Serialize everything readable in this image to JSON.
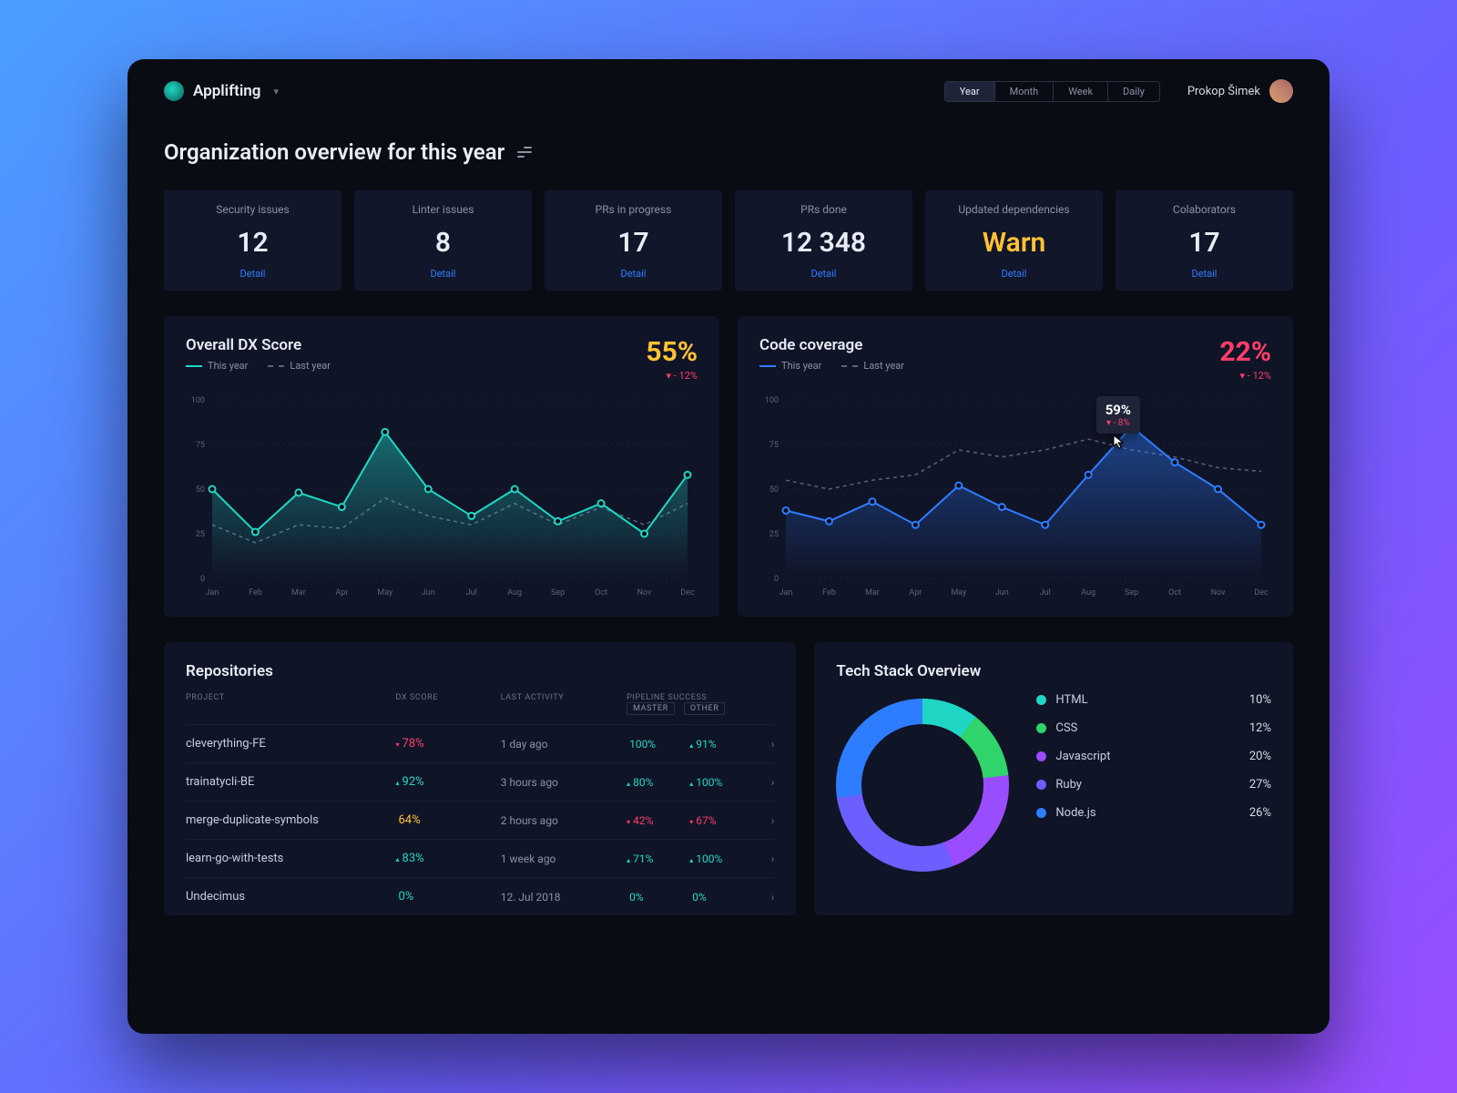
{
  "header": {
    "brand": "Applifting",
    "periods": [
      "Year",
      "Month",
      "Week",
      "Daily"
    ],
    "active_period": 0,
    "user": "Prokop Šimek"
  },
  "page_title": "Organization overview for this year",
  "stats": [
    {
      "label": "Security issues",
      "value": "12",
      "link": "Detail",
      "warn": false
    },
    {
      "label": "Linter issues",
      "value": "8",
      "link": "Detail",
      "warn": false
    },
    {
      "label": "PRs in progress",
      "value": "17",
      "link": "Detail",
      "warn": false
    },
    {
      "label": "PRs done",
      "value": "12 348",
      "link": "Detail",
      "warn": false
    },
    {
      "label": "Updated dependencies",
      "value": "Warn",
      "link": "Detail",
      "warn": true
    },
    {
      "label": "Colaborators",
      "value": "17",
      "link": "Detail",
      "warn": false
    }
  ],
  "dx_chart": {
    "title": "Overall DX Score",
    "value": "55%",
    "delta": "- 12%",
    "legend_this": "This year",
    "legend_last": "Last year",
    "color": "#1fd6c4"
  },
  "cov_chart": {
    "title": "Code coverage",
    "value": "22%",
    "delta": "- 12%",
    "legend_this": "This year",
    "legend_last": "Last year",
    "color": "#2e7cff",
    "tooltip_val": "59%",
    "tooltip_delta": "- 8%"
  },
  "chart_data": [
    {
      "type": "line",
      "title": "Overall DX Score",
      "categories": [
        "Jan",
        "Feb",
        "Mar",
        "Apr",
        "May",
        "Jun",
        "Jul",
        "Aug",
        "Sep",
        "Oct",
        "Nov",
        "Dec"
      ],
      "ylim": [
        0,
        100
      ],
      "series": [
        {
          "name": "This year",
          "values": [
            50,
            26,
            48,
            40,
            82,
            50,
            35,
            50,
            32,
            42,
            25,
            58
          ]
        },
        {
          "name": "Last year",
          "values": [
            30,
            20,
            30,
            28,
            45,
            35,
            30,
            42,
            30,
            40,
            30,
            42
          ]
        }
      ]
    },
    {
      "type": "line",
      "title": "Code coverage",
      "categories": [
        "Jan",
        "Feb",
        "Mar",
        "Apr",
        "May",
        "Jun",
        "Jul",
        "Aug",
        "Sep",
        "Oct",
        "Nov",
        "Dec"
      ],
      "ylim": [
        0,
        100
      ],
      "series": [
        {
          "name": "This year",
          "values": [
            38,
            32,
            43,
            30,
            52,
            40,
            30,
            58,
            85,
            65,
            50,
            30
          ]
        },
        {
          "name": "Last year",
          "values": [
            55,
            50,
            55,
            58,
            72,
            68,
            72,
            78,
            72,
            68,
            62,
            60
          ]
        }
      ]
    },
    {
      "type": "pie",
      "title": "Tech Stack Overview",
      "categories": [
        "HTML",
        "CSS",
        "Javascript",
        "Ruby",
        "Node.js"
      ],
      "values": [
        10,
        12,
        20,
        27,
        26
      ]
    }
  ],
  "repos": {
    "title": "Repositories",
    "col_project": "PROJECT",
    "col_score": "DX SCORE",
    "col_activity": "LAST ACTIVITY",
    "col_pipeline": "PIPELINE SUCCESS",
    "pipe_a": "master",
    "pipe_b": "other",
    "rows": [
      {
        "project": "cleverything-FE",
        "score": "78%",
        "score_dir": "down",
        "activity": "1 day ago",
        "master": "100%",
        "master_dir": "",
        "other": "91%",
        "other_dir": "up"
      },
      {
        "project": "trainatycli-BE",
        "score": "92%",
        "score_dir": "up",
        "activity": "3 hours ago",
        "master": "80%",
        "master_dir": "up",
        "other": "100%",
        "other_dir": "up"
      },
      {
        "project": "merge-duplicate-symbols",
        "score": "64%",
        "score_dir": "warn",
        "activity": "2 hours ago",
        "master": "42%",
        "master_dir": "down",
        "other": "67%",
        "other_dir": "down"
      },
      {
        "project": "learn-go-with-tests",
        "score": "83%",
        "score_dir": "up",
        "activity": "1 week ago",
        "master": "71%",
        "master_dir": "up",
        "other": "100%",
        "other_dir": "up"
      },
      {
        "project": "Undecimus",
        "score": "0%",
        "score_dir": "zero",
        "activity": "12. Jul 2018",
        "master": "0%",
        "master_dir": "",
        "other": "0%",
        "other_dir": ""
      }
    ]
  },
  "stack": {
    "title": "Tech Stack Overview",
    "items": [
      {
        "label": "HTML",
        "value": "10%",
        "color": "#1fd6c4"
      },
      {
        "label": "CSS",
        "value": "12%",
        "color": "#2fd46a"
      },
      {
        "label": "Javascript",
        "value": "20%",
        "color": "#9a4dff"
      },
      {
        "label": "Ruby",
        "value": "27%",
        "color": "#6b5fff"
      },
      {
        "label": "Node.js",
        "value": "26%",
        "color": "#2e7cff"
      }
    ]
  }
}
